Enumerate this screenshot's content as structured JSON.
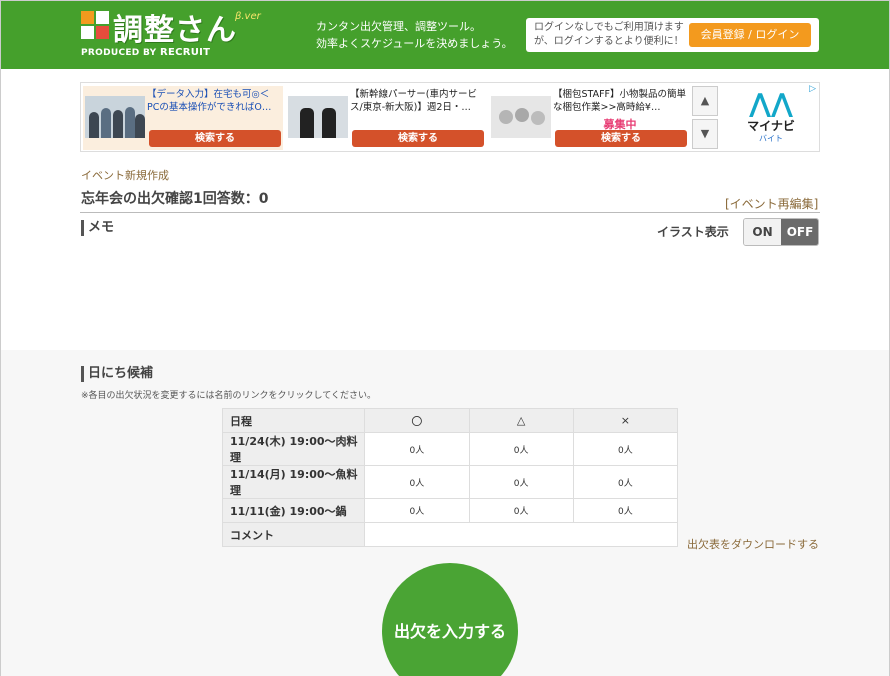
{
  "header": {
    "logo_title": "調整さん",
    "logo_beta": "β.ver",
    "logo_produced": "PRODUCED BY",
    "logo_recruit": "RECRUIT",
    "tagline_1": "カンタン出欠管理、調整ツール。",
    "tagline_2": "効率よくスケジュールを決めましょう。",
    "login_text_1": "ログインなしでもご利用頂けます",
    "login_text_2": "が、ログインするとより便利に！",
    "login_button": "会員登録 / ログイン"
  },
  "ad": {
    "items": [
      {
        "text": "【データ入力】在宅も可◎＜PCの基本操作ができればO…",
        "button": "検索する"
      },
      {
        "text": "【新幹線パーサー(車内サービス/東京-新大阪)】週2日・…",
        "button": "検索する"
      },
      {
        "text": "【梱包STAFF】小物製品の簡単な梱包作業>>高時給¥…",
        "recruiting": "募集中",
        "button": "検索する"
      }
    ],
    "up_arrow": "▲",
    "down_arrow": "▼",
    "brand_name": "マイナビ",
    "brand_sub": "バイト",
    "adchoice": "▷"
  },
  "event": {
    "breadcrumb": "イベント新規作成",
    "title": "忘年会の出欠確認1回答数：0",
    "reedit_link": "[イベント再編集]",
    "memo_label": "メモ",
    "illust_label": "イラスト表示",
    "toggle_on": "ON",
    "toggle_off": "OFF"
  },
  "candidates": {
    "title": "日にち候補",
    "note": "※各目の出欠状況を変更するには名前のリンクをクリックしてください。",
    "headers": [
      "日程",
      "〇",
      "△",
      "×"
    ],
    "rows": [
      {
        "date": "11/24(木) 19:00～肉料理",
        "yes": "0人",
        "maybe": "0人",
        "no": "0人"
      },
      {
        "date": "11/14(月) 19:00～魚料理",
        "yes": "0人",
        "maybe": "0人",
        "no": "0人"
      },
      {
        "date": "11/11(金) 19:00～鍋",
        "yes": "0人",
        "maybe": "0人",
        "no": "0人"
      }
    ],
    "comment_label": "コメント",
    "download_link": "出欠表をダウンロードする",
    "enter_button": "出欠を入力する"
  },
  "colors": {
    "header_green": "#45a02c",
    "login_orange": "#f39a1e",
    "ad_button": "#d4512a",
    "link_brown": "#8a6a3a",
    "enter_green": "#4aa434"
  }
}
